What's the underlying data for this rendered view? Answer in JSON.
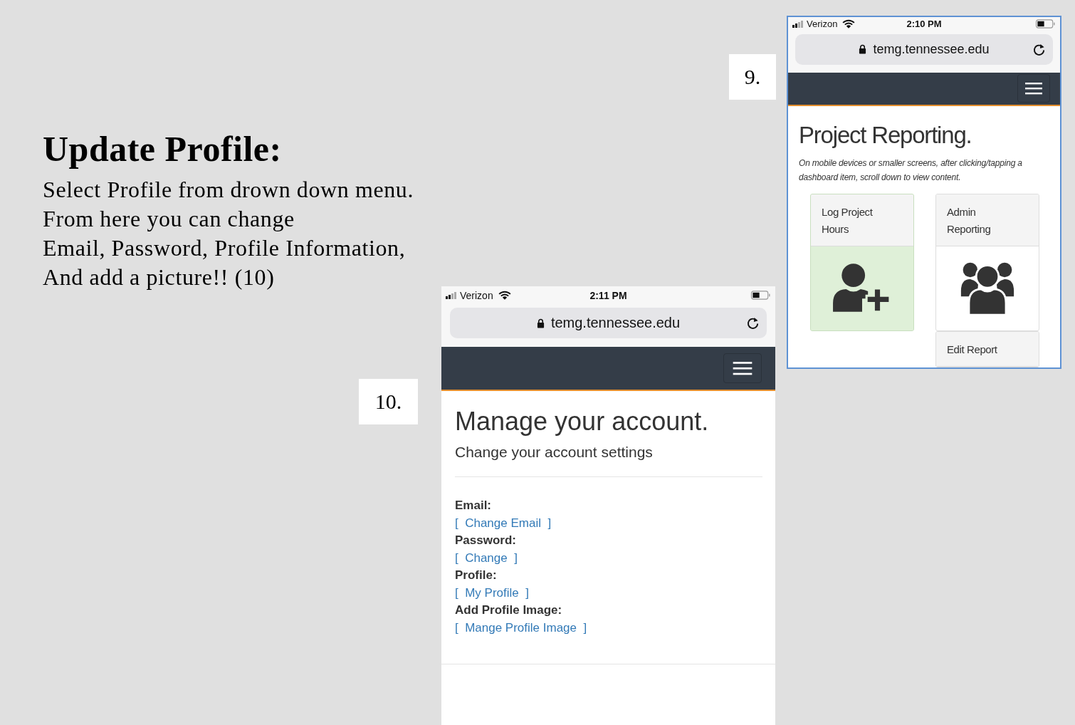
{
  "slide": {
    "title": "Update Profile:",
    "body_lines": [
      "Select Profile from drown down menu.",
      "From here you can change",
      "Email, Password, Profile Information,",
      "And add a picture!! (10)"
    ]
  },
  "step_labels": [
    {
      "text": "9."
    },
    {
      "text": "10."
    }
  ],
  "screenshot_9": {
    "status_bar": {
      "carrier": "Verizon",
      "time": "2:10 PM"
    },
    "address_bar": {
      "url": "temg.tennessee.edu"
    },
    "heading": "Project Reporting.",
    "note": "On mobile devices or smaller screens, after clicking/tapping a dashboard item, scroll down to view content.",
    "cards": [
      {
        "title": "Log Project Hours",
        "selected": true,
        "kind": "user-plus"
      },
      {
        "title": "Admin Reporting",
        "selected": false,
        "kind": "users"
      },
      {
        "title": "Edit Report",
        "selected": false,
        "kind": "none"
      }
    ]
  },
  "screenshot_10": {
    "status_bar": {
      "carrier": "Verizon",
      "time": "2:11 PM"
    },
    "address_bar": {
      "url": "temg.tennessee.edu"
    },
    "heading": "Manage your account.",
    "subheading": "Change your account settings",
    "settings": [
      {
        "label": "Email:",
        "link": "[  Change Email  ]"
      },
      {
        "label": "Password:",
        "link": "[  Change  ]"
      },
      {
        "label": "Profile:",
        "link": "[  My Profile  ]"
      },
      {
        "label": "Add Profile Image:",
        "link": "[  Mange Profile Image  ]"
      }
    ]
  }
}
